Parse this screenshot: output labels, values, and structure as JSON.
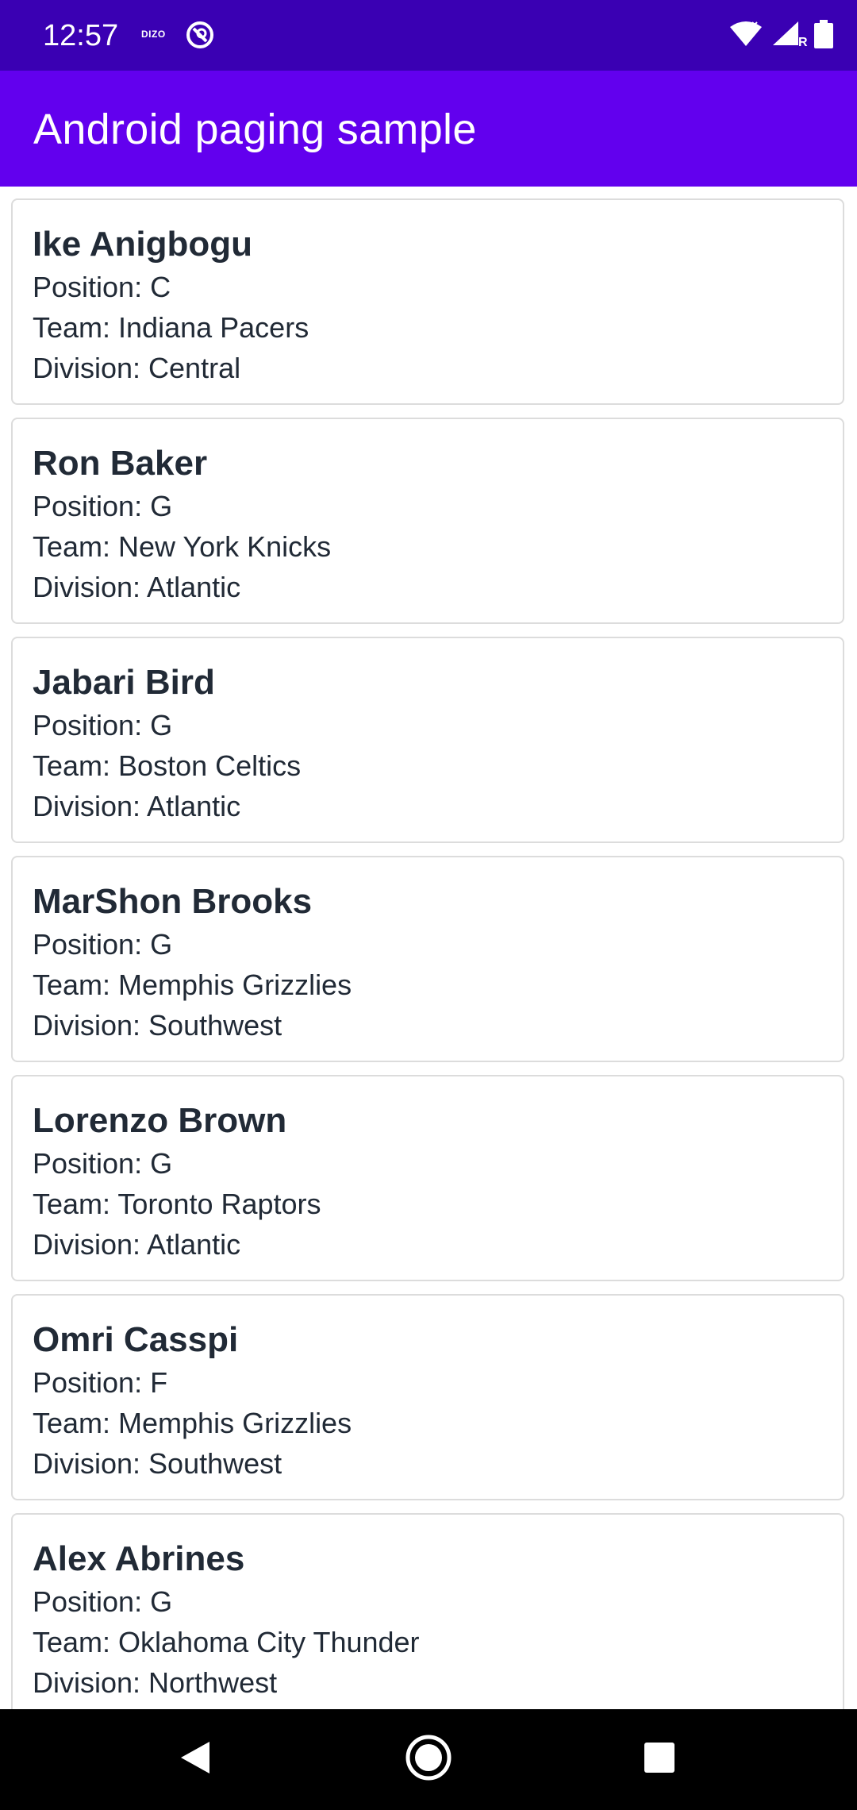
{
  "status_bar": {
    "time": "12:57",
    "carrier_label": "DIZO",
    "icons": [
      "app-notification-icon",
      "wifi-icon",
      "cellular-signal-icon",
      "battery-icon"
    ],
    "roaming_label": "R"
  },
  "app_bar": {
    "title": "Android paging sample",
    "color": "#6200ee",
    "status_color": "#3a00b3"
  },
  "players": [
    {
      "name": "Ike Anigbogu",
      "position": "Position: C",
      "team": "Team: Indiana Pacers",
      "division": "Division: Central"
    },
    {
      "name": "Ron Baker",
      "position": "Position: G",
      "team": "Team: New York Knicks",
      "division": "Division: Atlantic"
    },
    {
      "name": "Jabari Bird",
      "position": "Position: G",
      "team": "Team: Boston Celtics",
      "division": "Division: Atlantic"
    },
    {
      "name": "MarShon Brooks",
      "position": "Position: G",
      "team": "Team: Memphis Grizzlies",
      "division": "Division: Southwest"
    },
    {
      "name": "Lorenzo Brown",
      "position": "Position: G",
      "team": "Team: Toronto Raptors",
      "division": "Division: Atlantic"
    },
    {
      "name": "Omri Casspi",
      "position": "Position: F",
      "team": "Team: Memphis Grizzlies",
      "division": "Division: Southwest"
    },
    {
      "name": "Alex Abrines",
      "position": "Position: G",
      "team": "Team: Oklahoma City Thunder",
      "division": "Division: Northwest"
    }
  ],
  "nav_bar": {
    "icons": [
      "back-icon",
      "home-icon",
      "recents-icon"
    ]
  }
}
